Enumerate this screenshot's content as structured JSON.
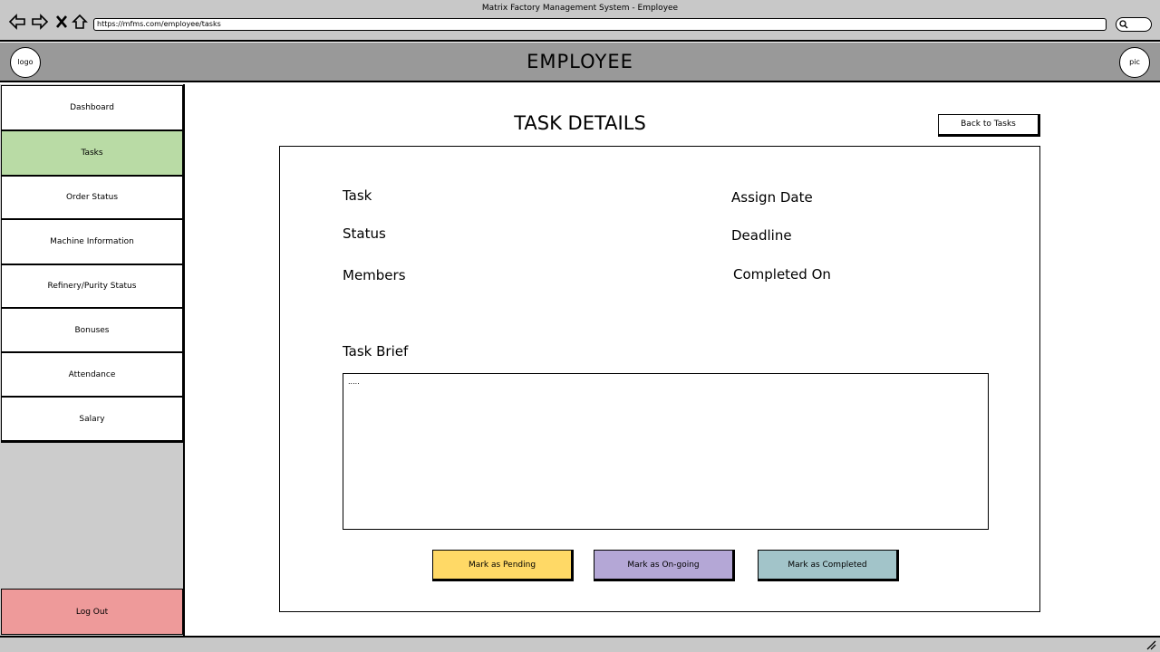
{
  "window": {
    "title": "Matrix Factory Management System - Employee"
  },
  "browser": {
    "url": "https://mfms.com/employee/tasks",
    "icons": [
      "back-arrow-icon",
      "forward-arrow-icon",
      "close-x-icon",
      "home-icon",
      "search-icon"
    ]
  },
  "header": {
    "title": "EMPLOYEE",
    "logo_label": "logo",
    "avatar_label": "pic"
  },
  "sidebar": {
    "items": [
      {
        "label": "Dashboard"
      },
      {
        "label": "Tasks"
      },
      {
        "label": "Order Status"
      },
      {
        "label": "Machine Information"
      },
      {
        "label": "Refinery/Purity Status"
      },
      {
        "label": "Bonuses"
      },
      {
        "label": "Attendance"
      },
      {
        "label": "Salary"
      }
    ],
    "active": "Tasks",
    "logout_label": "Log Out"
  },
  "main": {
    "title": "TASK DETAILS",
    "back_label": "Back to Tasks",
    "fields": {
      "task": "Task",
      "status": "Status",
      "members": "Members",
      "assign_date": "Assign Date",
      "deadline": "Deadline",
      "completed_on": "Completed On"
    },
    "brief_label": "Task Brief",
    "brief_text": ".....",
    "actions": {
      "pending": "Mark as Pending",
      "ongoing": "Mark as On-going",
      "completed": "Mark as Completed"
    }
  },
  "colors": {
    "header_bg": "#999999",
    "active_nav": "#b9dba5",
    "logout": "#ee9a9a",
    "pending": "#ffd966",
    "ongoing": "#b4a7d6",
    "completed": "#a2c4c9"
  }
}
